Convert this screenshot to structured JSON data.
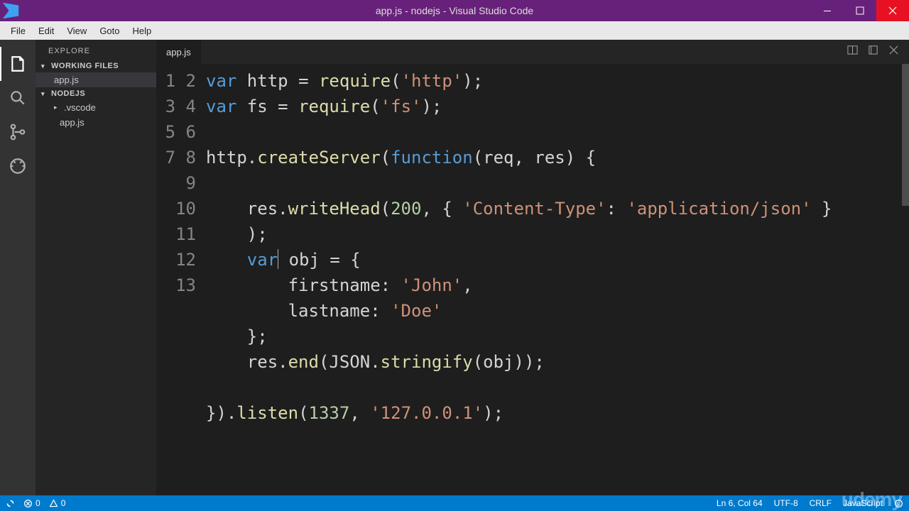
{
  "window": {
    "title": "app.js - nodejs - Visual Studio Code"
  },
  "menubar": [
    "File",
    "Edit",
    "View",
    "Goto",
    "Help"
  ],
  "sidebar": {
    "title": "EXPLORE",
    "sections": {
      "working_files": {
        "label": "WORKING FILES",
        "items": [
          "app.js"
        ]
      },
      "folder": {
        "label": "NODEJS",
        "items": [
          ".vscode",
          "app.js"
        ]
      }
    }
  },
  "tabs": {
    "active": "app.js"
  },
  "editor": {
    "linecount": 13,
    "code": {
      "l1": {
        "a": "var",
        "b": " http ",
        "c": "=",
        "d": " ",
        "e": "require",
        "f": "(",
        "g": "'http'",
        "h": ");"
      },
      "l2": {
        "a": "var",
        "b": " fs ",
        "c": "=",
        "d": " ",
        "e": "require",
        "f": "(",
        "g": "'fs'",
        "h": ");"
      },
      "l3": "",
      "l4": {
        "a": "http.",
        "b": "createServer",
        "c": "(",
        "d": "function",
        "e": "(req, res) {"
      },
      "l5": "",
      "l6a": {
        "a": "    res.",
        "b": "writeHead",
        "c": "(",
        "d": "200",
        "e": ", { ",
        "f": "'Content-Type'",
        "g": ": ",
        "h": "'application/json'",
        "i": " }"
      },
      "l6b": "    );",
      "l7": {
        "a": "    ",
        "b": "var",
        "c": " obj ",
        "d": "=",
        "e": " {"
      },
      "l8": {
        "a": "        firstname: ",
        "b": "'John'",
        "c": ","
      },
      "l9": {
        "a": "        lastname: ",
        "b": "'Doe'"
      },
      "l10": "    };",
      "l11": {
        "a": "    res.",
        "b": "end",
        "c": "(JSON.",
        "d": "stringify",
        "e": "(obj));"
      },
      "l12": "",
      "l13": {
        "a": "}).",
        "b": "listen",
        "c": "(",
        "d": "1337",
        "e": ", ",
        "f": "'127.0.0.1'",
        "g": ");"
      }
    }
  },
  "statusbar": {
    "errors": "0",
    "warnings": "0",
    "position": "Ln 6, Col 64",
    "encoding": "UTF-8",
    "eol": "CRLF",
    "language": "JavaScript"
  },
  "watermark": "udemy"
}
